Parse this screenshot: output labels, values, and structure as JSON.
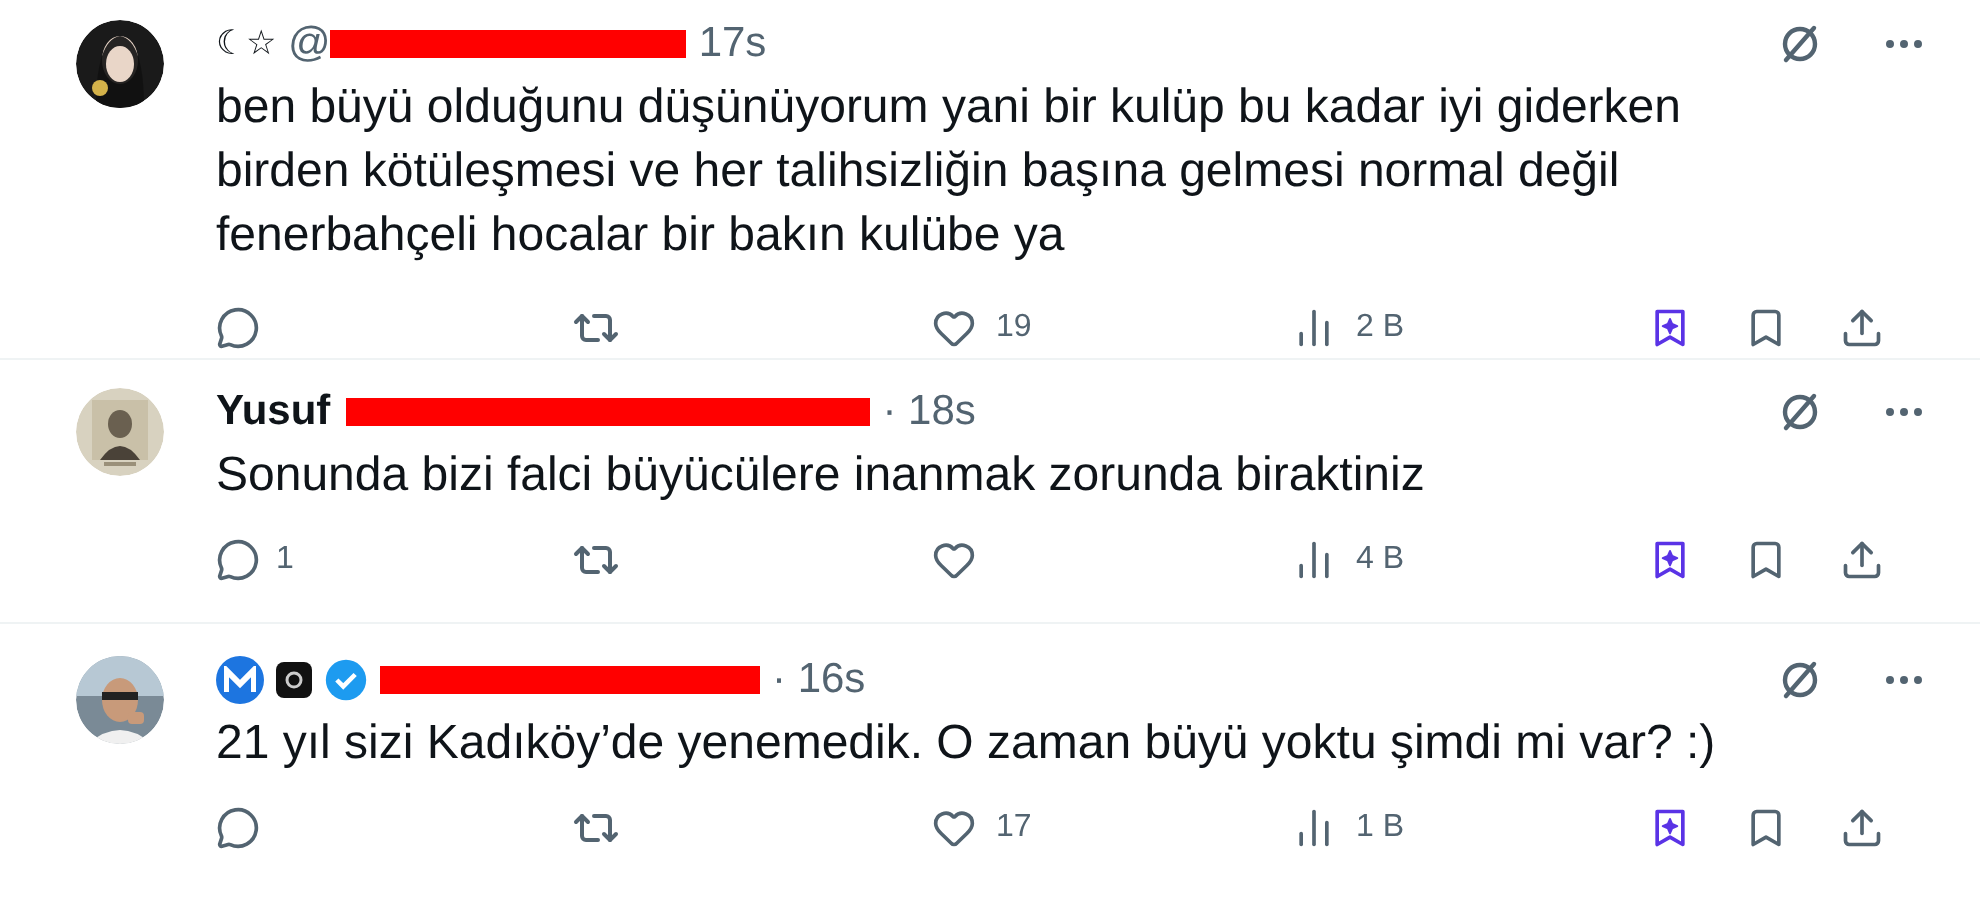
{
  "posts": [
    {
      "prefix": "☾☆",
      "handle": "@",
      "time": "17s",
      "verified": false,
      "text": [
        "ben büyü olduğunu düşünüyorum yani bir kulüp bu kadar iyi giderken",
        "birden kötüleşmesi ve her talihsizliğin başına gelmesi normal değil",
        "fenerbahçeli hocalar bir bakın kulübe ya"
      ],
      "likes": "19",
      "views": "2 B"
    },
    {
      "name": "Yusuf",
      "time": "· 18s",
      "verified": false,
      "text": [
        "Sonunda bizi falci büyücülere inanmak zorunda biraktiniz"
      ],
      "replies": "1",
      "views": "4 B"
    },
    {
      "time": "· 16s",
      "verified": true,
      "text": [
        "21 yıl sizi Kadıköy’de yenemedik. O zaman büyü yoktu şimdi mi var? :)"
      ],
      "likes": "17",
      "views": "1 B"
    }
  ]
}
